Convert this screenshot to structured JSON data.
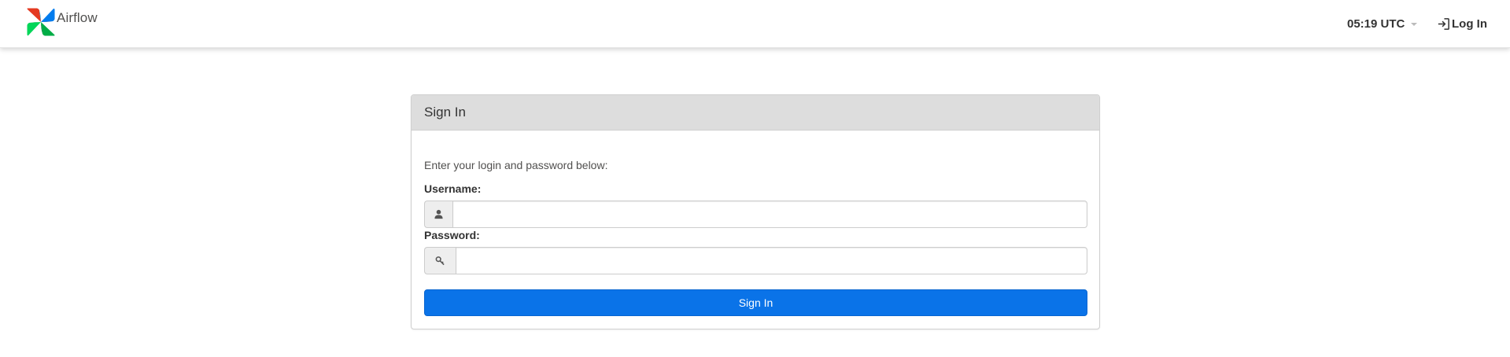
{
  "navbar": {
    "brand_text": "Airflow",
    "clock_text": "05:19 UTC",
    "login_label": "Log In"
  },
  "panel": {
    "title": "Sign In",
    "intro": "Enter your login and password below:",
    "username_label": "Username:",
    "username_value": "",
    "password_label": "Password:",
    "password_value": "",
    "submit_label": "Sign In"
  },
  "icons": {
    "logo": "airflow-pinwheel-logo",
    "login": "sign-in-icon",
    "user": "user-icon",
    "key": "key-icon"
  },
  "colors": {
    "primary_button": "#0a73e8",
    "panel_heading_bg": "#dddddd",
    "logo_red": "#e43921",
    "logo_blue": "#017cee",
    "logo_green": "#00ad46",
    "logo_teal": "#04d659"
  }
}
